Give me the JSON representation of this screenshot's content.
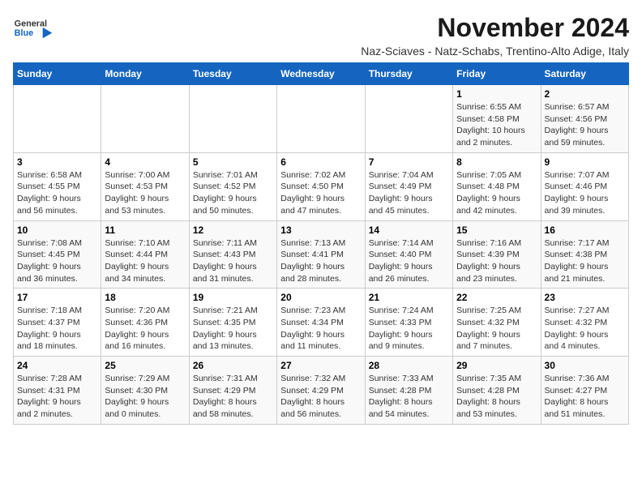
{
  "logo": {
    "line1": "General",
    "line2": "Blue",
    "arrow": "▶"
  },
  "title": "November 2024",
  "subtitle": "Naz-Sciaves - Natz-Schabs, Trentino-Alto Adige, Italy",
  "columns": [
    "Sunday",
    "Monday",
    "Tuesday",
    "Wednesday",
    "Thursday",
    "Friday",
    "Saturday"
  ],
  "weeks": [
    [
      {
        "day": "",
        "info": ""
      },
      {
        "day": "",
        "info": ""
      },
      {
        "day": "",
        "info": ""
      },
      {
        "day": "",
        "info": ""
      },
      {
        "day": "",
        "info": ""
      },
      {
        "day": "1",
        "info": "Sunrise: 6:55 AM\nSunset: 4:58 PM\nDaylight: 10 hours\nand 2 minutes."
      },
      {
        "day": "2",
        "info": "Sunrise: 6:57 AM\nSunset: 4:56 PM\nDaylight: 9 hours\nand 59 minutes."
      }
    ],
    [
      {
        "day": "3",
        "info": "Sunrise: 6:58 AM\nSunset: 4:55 PM\nDaylight: 9 hours\nand 56 minutes."
      },
      {
        "day": "4",
        "info": "Sunrise: 7:00 AM\nSunset: 4:53 PM\nDaylight: 9 hours\nand 53 minutes."
      },
      {
        "day": "5",
        "info": "Sunrise: 7:01 AM\nSunset: 4:52 PM\nDaylight: 9 hours\nand 50 minutes."
      },
      {
        "day": "6",
        "info": "Sunrise: 7:02 AM\nSunset: 4:50 PM\nDaylight: 9 hours\nand 47 minutes."
      },
      {
        "day": "7",
        "info": "Sunrise: 7:04 AM\nSunset: 4:49 PM\nDaylight: 9 hours\nand 45 minutes."
      },
      {
        "day": "8",
        "info": "Sunrise: 7:05 AM\nSunset: 4:48 PM\nDaylight: 9 hours\nand 42 minutes."
      },
      {
        "day": "9",
        "info": "Sunrise: 7:07 AM\nSunset: 4:46 PM\nDaylight: 9 hours\nand 39 minutes."
      }
    ],
    [
      {
        "day": "10",
        "info": "Sunrise: 7:08 AM\nSunset: 4:45 PM\nDaylight: 9 hours\nand 36 minutes."
      },
      {
        "day": "11",
        "info": "Sunrise: 7:10 AM\nSunset: 4:44 PM\nDaylight: 9 hours\nand 34 minutes."
      },
      {
        "day": "12",
        "info": "Sunrise: 7:11 AM\nSunset: 4:43 PM\nDaylight: 9 hours\nand 31 minutes."
      },
      {
        "day": "13",
        "info": "Sunrise: 7:13 AM\nSunset: 4:41 PM\nDaylight: 9 hours\nand 28 minutes."
      },
      {
        "day": "14",
        "info": "Sunrise: 7:14 AM\nSunset: 4:40 PM\nDaylight: 9 hours\nand 26 minutes."
      },
      {
        "day": "15",
        "info": "Sunrise: 7:16 AM\nSunset: 4:39 PM\nDaylight: 9 hours\nand 23 minutes."
      },
      {
        "day": "16",
        "info": "Sunrise: 7:17 AM\nSunset: 4:38 PM\nDaylight: 9 hours\nand 21 minutes."
      }
    ],
    [
      {
        "day": "17",
        "info": "Sunrise: 7:18 AM\nSunset: 4:37 PM\nDaylight: 9 hours\nand 18 minutes."
      },
      {
        "day": "18",
        "info": "Sunrise: 7:20 AM\nSunset: 4:36 PM\nDaylight: 9 hours\nand 16 minutes."
      },
      {
        "day": "19",
        "info": "Sunrise: 7:21 AM\nSunset: 4:35 PM\nDaylight: 9 hours\nand 13 minutes."
      },
      {
        "day": "20",
        "info": "Sunrise: 7:23 AM\nSunset: 4:34 PM\nDaylight: 9 hours\nand 11 minutes."
      },
      {
        "day": "21",
        "info": "Sunrise: 7:24 AM\nSunset: 4:33 PM\nDaylight: 9 hours\nand 9 minutes."
      },
      {
        "day": "22",
        "info": "Sunrise: 7:25 AM\nSunset: 4:32 PM\nDaylight: 9 hours\nand 7 minutes."
      },
      {
        "day": "23",
        "info": "Sunrise: 7:27 AM\nSunset: 4:32 PM\nDaylight: 9 hours\nand 4 minutes."
      }
    ],
    [
      {
        "day": "24",
        "info": "Sunrise: 7:28 AM\nSunset: 4:31 PM\nDaylight: 9 hours\nand 2 minutes."
      },
      {
        "day": "25",
        "info": "Sunrise: 7:29 AM\nSunset: 4:30 PM\nDaylight: 9 hours\nand 0 minutes."
      },
      {
        "day": "26",
        "info": "Sunrise: 7:31 AM\nSunset: 4:29 PM\nDaylight: 8 hours\nand 58 minutes."
      },
      {
        "day": "27",
        "info": "Sunrise: 7:32 AM\nSunset: 4:29 PM\nDaylight: 8 hours\nand 56 minutes."
      },
      {
        "day": "28",
        "info": "Sunrise: 7:33 AM\nSunset: 4:28 PM\nDaylight: 8 hours\nand 54 minutes."
      },
      {
        "day": "29",
        "info": "Sunrise: 7:35 AM\nSunset: 4:28 PM\nDaylight: 8 hours\nand 53 minutes."
      },
      {
        "day": "30",
        "info": "Sunrise: 7:36 AM\nSunset: 4:27 PM\nDaylight: 8 hours\nand 51 minutes."
      }
    ]
  ]
}
